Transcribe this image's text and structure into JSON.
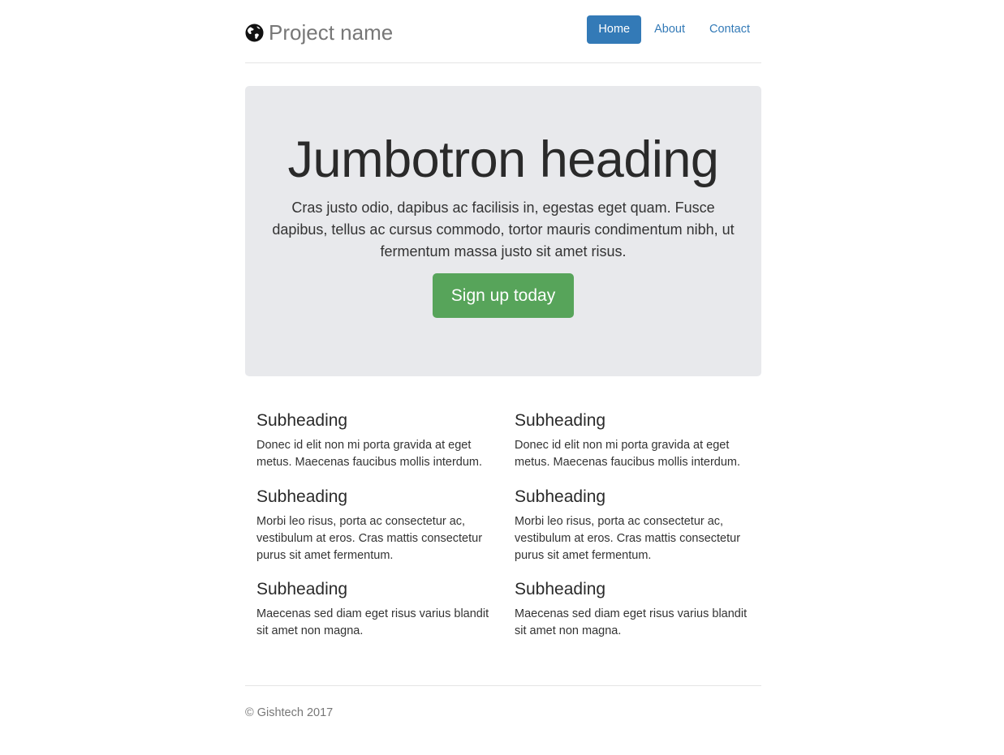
{
  "header": {
    "brand_icon": "globe-icon",
    "brand_name": "Project name",
    "nav": [
      {
        "label": "Home",
        "active": true
      },
      {
        "label": "About",
        "active": false
      },
      {
        "label": "Contact",
        "active": false
      }
    ]
  },
  "jumbotron": {
    "heading": "Jumbotron heading",
    "text": "Cras justo odio, dapibus ac facilisis in, egestas eget quam. Fusce dapibus, tellus ac cursus commodo, tortor mauris condimentum nibh, ut fermentum massa justo sit amet risus.",
    "button_label": "Sign up today"
  },
  "marketing": {
    "left": [
      {
        "heading": "Subheading",
        "text": "Donec id elit non mi porta gravida at eget metus. Maecenas faucibus mollis interdum."
      },
      {
        "heading": "Subheading",
        "text": "Morbi leo risus, porta ac consectetur ac, vestibulum at eros. Cras mattis consectetur purus sit amet fermentum."
      },
      {
        "heading": "Subheading",
        "text": "Maecenas sed diam eget risus varius blandit sit amet non magna."
      }
    ],
    "right": [
      {
        "heading": "Subheading",
        "text": "Donec id elit non mi porta gravida at eget metus. Maecenas faucibus mollis interdum."
      },
      {
        "heading": "Subheading",
        "text": "Morbi leo risus, porta ac consectetur ac, vestibulum at eros. Cras mattis consectetur purus sit amet fermentum."
      },
      {
        "heading": "Subheading",
        "text": "Maecenas sed diam eget risus varius blandit sit amet non magna."
      }
    ]
  },
  "footer": {
    "text": "© Gishtech 2017"
  },
  "colors": {
    "primary": "#337ab7",
    "success": "#57a45a",
    "jumbotron_bg": "#e8e9ec",
    "muted": "#777777"
  }
}
